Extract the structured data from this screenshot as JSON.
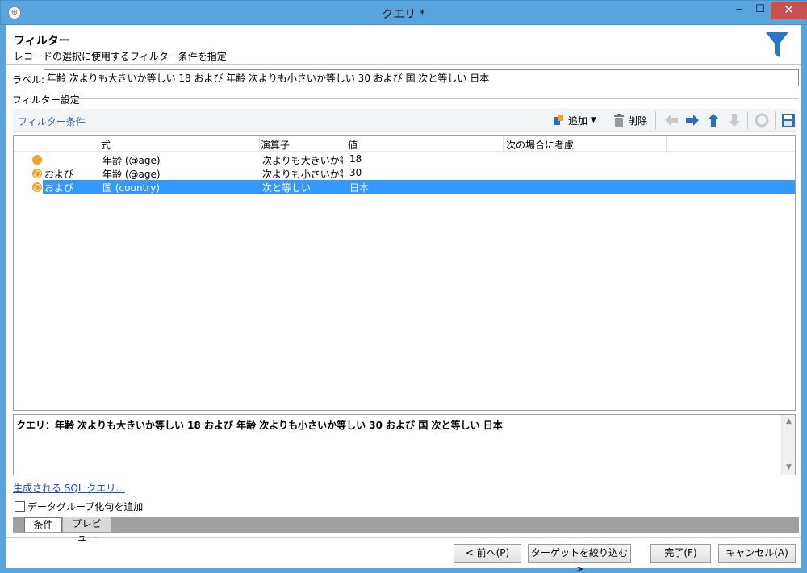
{
  "window": {
    "title": "クエリ *",
    "minimize": "‒",
    "maximize": "☐",
    "close": "✕"
  },
  "header": {
    "title": "フィルター",
    "subtitle": "レコードの選択に使用するフィルター条件を指定"
  },
  "label_field": {
    "caption": "ラベル:",
    "value": "年齢 次よりも大きいか等しい 18 および 年齢 次よりも小さいか等しい 30 および 国 次と等しい 日本"
  },
  "filter_settings": {
    "caption": "フィルター設定"
  },
  "toolbar": {
    "caption": "フィルター条件",
    "add_label": "追加",
    "delete_label": "削除"
  },
  "grid": {
    "columns": [
      "式",
      "演算子",
      "値",
      "次の場合に考慮"
    ],
    "rows": [
      {
        "conj": "",
        "expr": "年齢 (@age)",
        "op": "次よりも大きいか等...",
        "value": "18",
        "consider": "",
        "selected": false
      },
      {
        "conj": "および",
        "expr": "年齢 (@age)",
        "op": "次よりも小さいか等...",
        "value": "30",
        "consider": "",
        "selected": false
      },
      {
        "conj": "および",
        "expr": "国 (country)",
        "op": "次と等しい",
        "value": "日本",
        "consider": "",
        "selected": true
      }
    ]
  },
  "query_preview": {
    "text": "クエリ：年齢 次よりも大きいか等しい 18 および 年齢 次よりも小さいか等しい 30 および 国 次と等しい 日本"
  },
  "sql_link": "生成される SQL クエリ...",
  "group_checkbox": {
    "label": "データグループ化句を追加",
    "checked": false
  },
  "tabs": [
    "条件",
    "プレビュー"
  ],
  "buttons": {
    "prev": "< 前へ(P)",
    "target": "ターゲットを絞り込む>",
    "finish": "完了(F)",
    "cancel": "キャンセル(A)"
  }
}
